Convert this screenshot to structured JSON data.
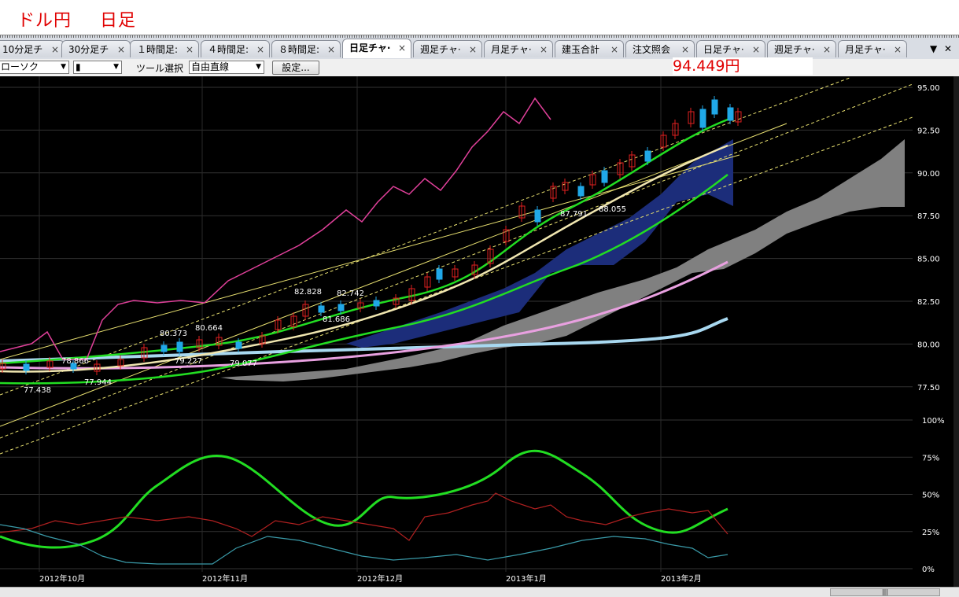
{
  "window": {
    "title_pair": "ドル円",
    "title_period": "日足",
    "price_display": "94.449円"
  },
  "tabs": [
    {
      "label": "10分足チ",
      "active": false
    },
    {
      "label": "30分足チ",
      "active": false
    },
    {
      "label": "１時間足:",
      "active": false
    },
    {
      "label": "４時間足:",
      "active": false
    },
    {
      "label": "８時間足:",
      "active": false
    },
    {
      "label": "日足チャ·",
      "active": true
    },
    {
      "label": "週足チャ·",
      "active": false
    },
    {
      "label": "月足チャ·",
      "active": false
    },
    {
      "label": "建玉合計",
      "active": false
    },
    {
      "label": "注文照会",
      "active": false
    },
    {
      "label": "日足チャ·",
      "active": false
    },
    {
      "label": "週足チャ·",
      "active": false
    },
    {
      "label": "月足チャ·",
      "active": false
    }
  ],
  "tab_close": "×",
  "tab_controls": {
    "dropdown": "▼",
    "close": "✕"
  },
  "toolbar": {
    "chart_type": "ローソク",
    "candle_style": "▮",
    "tool_label": "ツール選択",
    "tool_value": "自由直線",
    "settings_button": "設定..."
  },
  "chart_data": {
    "type": "line",
    "price_axis_ticks": [
      "95.00",
      "92.50",
      "90.00",
      "87.50",
      "85.00",
      "82.50",
      "80.00",
      "77.50"
    ],
    "oscillator_axis_ticks": [
      "100%",
      "75%",
      "50%",
      "25%",
      "0%"
    ],
    "x_tick_labels": [
      "2012年10月",
      "2012年11月",
      "2012年12月",
      "2013年1月",
      "2013年2月"
    ],
    "price_labels": [
      "77.438",
      "77.944",
      "78.866",
      "80.373",
      "80.664",
      "79.227",
      "79.077",
      "82.828",
      "82.742",
      "81.686",
      "87.791",
      "88.055"
    ],
    "ylim": [
      76.8,
      95.3
    ],
    "colors": {
      "candle_up": "#e02020",
      "candle_down": "#20a8e8",
      "ma_short": "#f0e6b0",
      "ma_green": "#22dd22",
      "ma_pink": "#e8a0e0",
      "ma_lightblue": "#a8d8f0",
      "cloud_blue": "#1c2d7a",
      "cloud_grey": "#808080",
      "rsi_pink": "#e0409a",
      "channel": "#e8e070",
      "osc_green": "#22dd22",
      "osc_red": "#b02020",
      "osc_teal": "#3a9aa8"
    }
  },
  "scrollbar": {
    "thumb_label": "|||"
  }
}
